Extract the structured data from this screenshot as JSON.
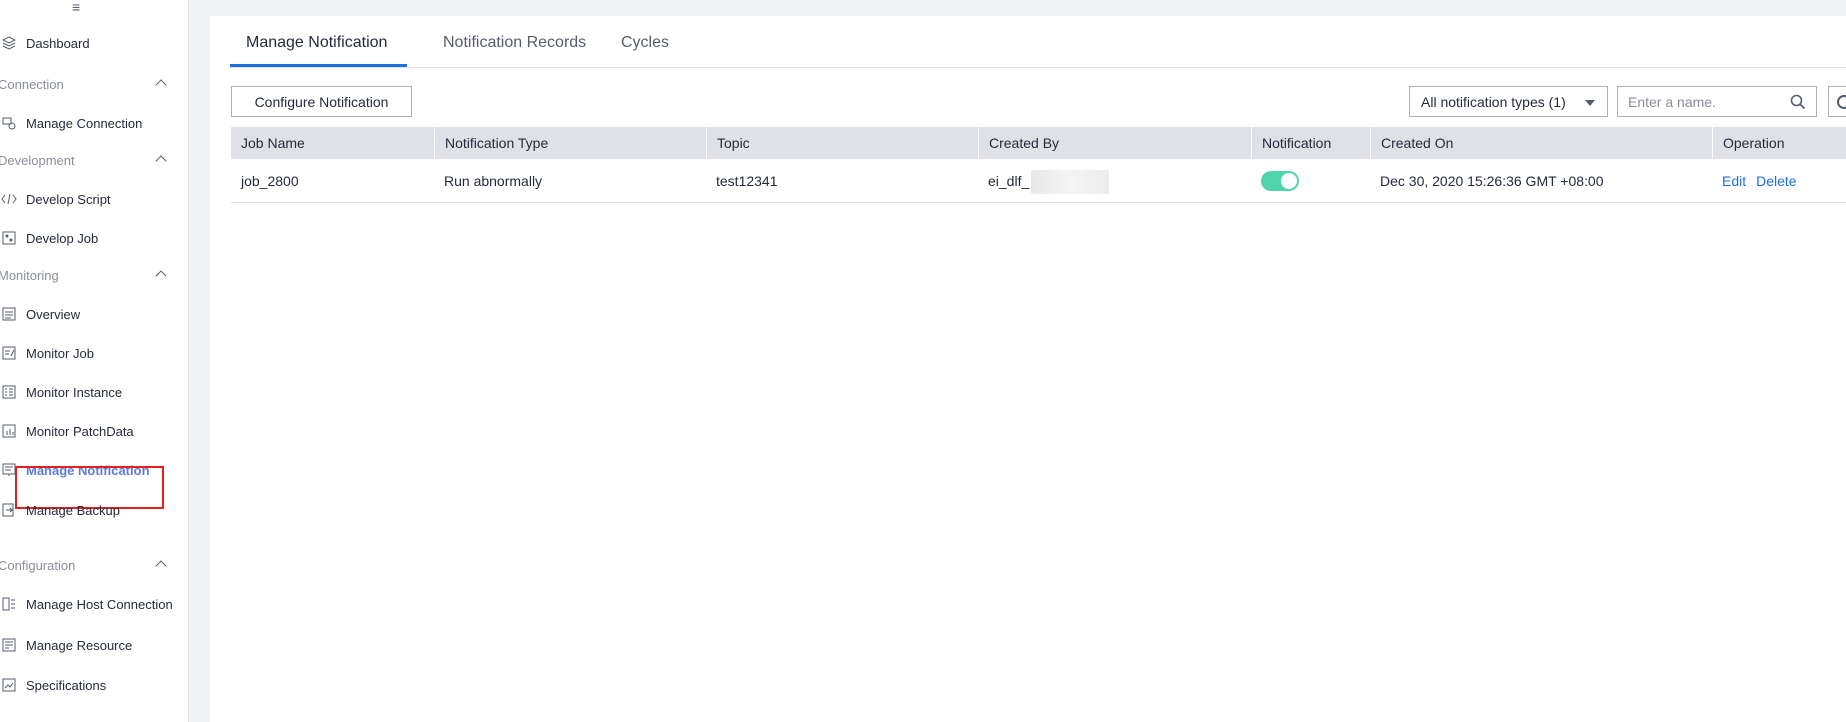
{
  "sidebar": {
    "collapse_glyph": "≡",
    "dashboard": "Dashboard",
    "groups": {
      "connection": "Connection",
      "development": "Development",
      "monitoring": "Monitoring",
      "configuration": "Configuration"
    },
    "items": {
      "manage_connection": "Manage Connection",
      "develop_script": "Develop Script",
      "develop_job": "Develop Job",
      "overview": "Overview",
      "monitor_job": "Monitor Job",
      "monitor_instance": "Monitor Instance",
      "monitor_patchdata": "Monitor PatchData",
      "manage_notification": "Manage Notification",
      "manage_backup": "Manage Backup",
      "manage_host_connection": "Manage Host Connection",
      "manage_resource": "Manage Resource",
      "specifications": "Specifications"
    },
    "active_item": "Manage Notification"
  },
  "tabs": {
    "manage_notification": "Manage Notification",
    "notification_records": "Notification Records",
    "cycles": "Cycles"
  },
  "toolbar": {
    "configure_button": "Configure Notification",
    "type_filter": "All notification types (1)",
    "search_placeholder": "Enter a name."
  },
  "table": {
    "headers": {
      "job_name": "Job Name",
      "notification_type": "Notification Type",
      "topic": "Topic",
      "created_by": "Created By",
      "notification": "Notification",
      "created_on": "Created On",
      "operation": "Operation"
    },
    "rows": [
      {
        "job_name": "job_2800",
        "notification_type": "Run abnormally",
        "topic": "test12341",
        "created_by": "ei_dlf_",
        "notification_enabled": true,
        "created_on": "Dec 30, 2020 15:26:36 GMT +08:00",
        "edit": "Edit",
        "delete": "Delete"
      }
    ]
  },
  "colors": {
    "accent": "#1e6fe0",
    "active_nav": "#5e7ce0",
    "toggle_on": "#50d4ab",
    "highlight": "#e02020"
  }
}
